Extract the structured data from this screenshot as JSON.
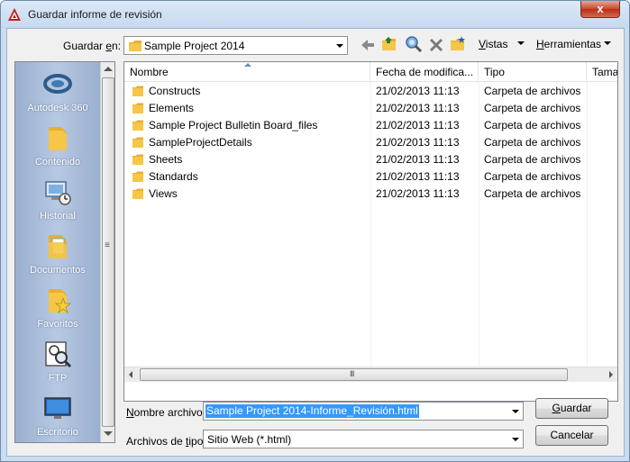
{
  "window": {
    "title": "Guardar informe de revisión",
    "close_symbol": "x"
  },
  "save_in": {
    "label_pre": "Guardar ",
    "label_ul": "e",
    "label_post": "n:",
    "value": "Sample Project 2014"
  },
  "toolbar": {
    "back_icon": "back-arrow-icon",
    "up_icon": "folder-up-icon",
    "search_web_icon": "search-web-icon",
    "delete_icon": "delete-icon",
    "new_folder_icon": "new-folder-icon",
    "views_ul": "V",
    "views_rest": "istas",
    "tools_ul": "H",
    "tools_rest": "erramientas"
  },
  "places": [
    {
      "label": "Autodesk 360",
      "icon": "autodesk360-icon"
    },
    {
      "label": "Contenido",
      "icon": "folder-icon"
    },
    {
      "label": "Historial",
      "icon": "history-icon"
    },
    {
      "label": "Documentos",
      "icon": "documents-icon"
    },
    {
      "label": "Favoritos",
      "icon": "favorites-icon"
    },
    {
      "label": "FTP",
      "icon": "ftp-icon"
    },
    {
      "label": "Escritorio",
      "icon": "desktop-icon"
    }
  ],
  "columns": [
    "Nombre",
    "Fecha de modifica...",
    "Tipo",
    "Tama"
  ],
  "files": [
    {
      "name": "Constructs",
      "date": "21/02/2013 11:13",
      "type": "Carpeta de archivos"
    },
    {
      "name": "Elements",
      "date": "21/02/2013 11:13",
      "type": "Carpeta de archivos"
    },
    {
      "name": "Sample Project Bulletin Board_files",
      "date": "21/02/2013 11:13",
      "type": "Carpeta de archivos"
    },
    {
      "name": "SampleProjectDetails",
      "date": "21/02/2013 11:13",
      "type": "Carpeta de archivos"
    },
    {
      "name": "Sheets",
      "date": "21/02/2013 11:13",
      "type": "Carpeta de archivos"
    },
    {
      "name": "Standards",
      "date": "21/02/2013 11:13",
      "type": "Carpeta de archivos"
    },
    {
      "name": "Views",
      "date": "21/02/2013 11:13",
      "type": "Carpeta de archivos"
    }
  ],
  "hscroll_grip": "III",
  "vscroll_grip": "≡",
  "filename": {
    "label_ul": "N",
    "label_rest": "ombre archivo:",
    "value": "Sample Project 2014-Informe_Revisión.html"
  },
  "filetype": {
    "label_pre": "Archivos de ",
    "label_ul": "t",
    "label_post": "ipo:",
    "value": "Sitio Web (*.html)"
  },
  "buttons": {
    "save_ul": "G",
    "save_rest": "uardar",
    "cancel": "Cancelar"
  },
  "colors": {
    "selection": "#3399ff",
    "folder": "#f5c648",
    "places_bg": "#9ab0d0"
  }
}
